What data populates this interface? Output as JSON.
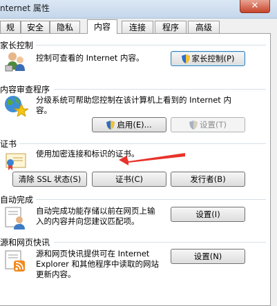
{
  "window": {
    "title": "nternet 属性",
    "close_glyph": "✕"
  },
  "tabs": [
    {
      "label": "规"
    },
    {
      "label": "安全"
    },
    {
      "label": "隐私"
    },
    {
      "label": "内容"
    },
    {
      "label": "连接"
    },
    {
      "label": "程序"
    },
    {
      "label": "高级"
    }
  ],
  "active_tab": "内容",
  "parental": {
    "title": "家长控制",
    "description": "控制可查看的 Internet 内容。",
    "button": "家长控制(P)"
  },
  "advisor": {
    "title": "内容审查程序",
    "description_line1": "分级系统可帮助您控制在该计算机上看到的 Internet 内",
    "description_line2": "容。",
    "enable_button": "启用(E)...",
    "settings_button": "设置(T)"
  },
  "certificates": {
    "title": "证书",
    "description": "使用加密连接和标识的证书。",
    "clear_ssl_button": "清除 SSL 状态(S)",
    "certificates_button": "证书(C)",
    "publishers_button": "发行者(B)"
  },
  "autocomplete": {
    "title": "自动完成",
    "description_line1": "自动完成功能存储以前在网页上输",
    "description_line2": "入的内容并向您建议匹配项。",
    "settings_button": "设置(I)"
  },
  "feeds": {
    "title": "源和网页快讯",
    "description_line1": "源和网页快讯提供可在 Internet",
    "description_line2": "Explorer 和其他程序中读取的网站",
    "description_line3": "更新内容。",
    "settings_button": "设置(N)"
  },
  "colors": {
    "annotation_arrow": "#e8332a",
    "section_line": "#d5dfe5",
    "focus_border": "#3c7fb1"
  }
}
